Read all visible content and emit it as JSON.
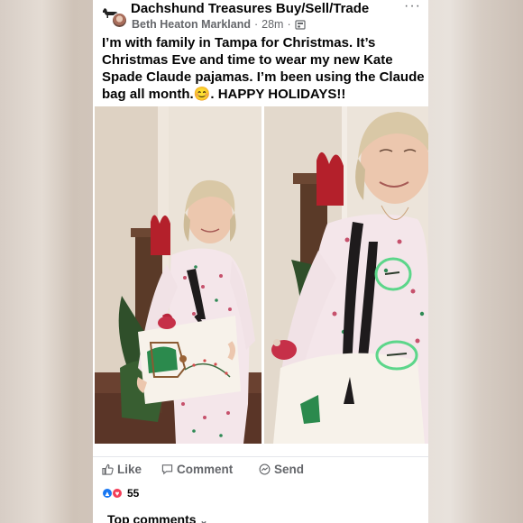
{
  "post": {
    "group_name": "Dachshund Treasures Buy/Sell/Trade",
    "author": "Beth Heaton Markland",
    "time": "28m",
    "separator": "·",
    "text_line1": "I’m with family in Tampa for Christmas.  It’s",
    "text_line2": "Christmas Eve and time to wear my new Kate",
    "text_line3": "Spade Claude pajamas.  I’m been using the Claude",
    "text_line4": "bag all month.",
    "text_emoji": "😊",
    "text_line4_end": ".    HAPPY HOLIDAYS!!",
    "more": "···"
  },
  "actions": {
    "like": "Like",
    "comment": "Comment",
    "send": "Send"
  },
  "reactions": {
    "count": "55"
  },
  "comments": {
    "header": "Top comments",
    "chevron": "⌄"
  },
  "icons": {
    "avatar": "dachshund-silhouette-icon",
    "privacy": "group-privacy-icon",
    "like": "thumbs-up-icon",
    "comment": "comment-bubble-icon",
    "send": "messenger-icon"
  },
  "colors": {
    "text": "#050505",
    "secondary": "#65676b",
    "like_blue": "#1877f2",
    "heart_red": "#f33e58",
    "highlight_green": "#5cd68a"
  }
}
